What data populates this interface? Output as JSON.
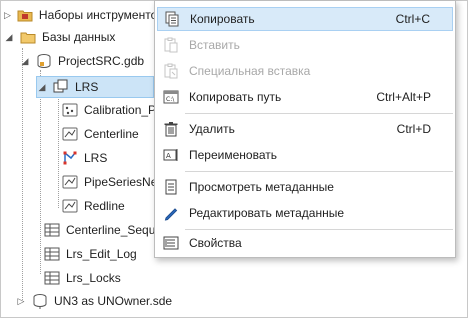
{
  "tree": {
    "items": [
      {
        "label": "Наборы инструментов"
      },
      {
        "label": "Базы данных"
      },
      {
        "label": "ProjectSRC.gdb"
      },
      {
        "label": "LRS"
      },
      {
        "label": "Calibration_Point"
      },
      {
        "label": "Centerline"
      },
      {
        "label": "LRS"
      },
      {
        "label": "PipeSeriesNetwork"
      },
      {
        "label": "Redline"
      },
      {
        "label": "Centerline_Sequence"
      },
      {
        "label": "Lrs_Edit_Log"
      },
      {
        "label": "Lrs_Locks"
      },
      {
        "label": "UN3 as UNOwner.sde"
      }
    ]
  },
  "menu": {
    "copy": {
      "label": "Копировать",
      "shortcut": "Ctrl+C"
    },
    "paste": {
      "label": "Вставить"
    },
    "paste_special": {
      "label": "Специальная вставка"
    },
    "copy_path": {
      "label": "Копировать путь",
      "shortcut": "Ctrl+Alt+P"
    },
    "delete": {
      "label": "Удалить",
      "shortcut": "Ctrl+D"
    },
    "rename": {
      "label": "Переименовать"
    },
    "view_metadata": {
      "label": "Просмотреть метаданные"
    },
    "edit_metadata": {
      "label": "Редактировать метаданные"
    },
    "properties": {
      "label": "Свойства"
    }
  },
  "colors": {
    "selection": "#cce4f7",
    "menu_hover": "#d8eaf9",
    "disabled_text": "#a8a8a8"
  }
}
